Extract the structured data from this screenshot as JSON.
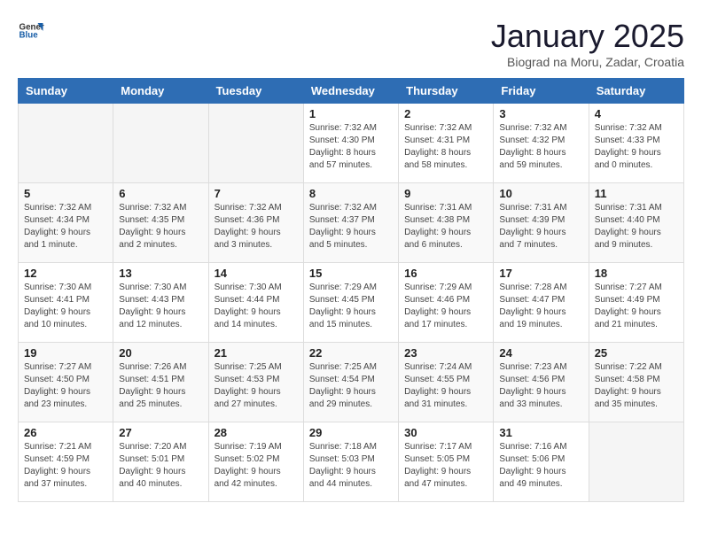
{
  "logo": {
    "text_general": "General",
    "text_blue": "Blue"
  },
  "title": "January 2025",
  "subtitle": "Biograd na Moru, Zadar, Croatia",
  "weekdays": [
    "Sunday",
    "Monday",
    "Tuesday",
    "Wednesday",
    "Thursday",
    "Friday",
    "Saturday"
  ],
  "weeks": [
    [
      {
        "day": "",
        "info": ""
      },
      {
        "day": "",
        "info": ""
      },
      {
        "day": "",
        "info": ""
      },
      {
        "day": "1",
        "info": "Sunrise: 7:32 AM\nSunset: 4:30 PM\nDaylight: 8 hours and 57 minutes."
      },
      {
        "day": "2",
        "info": "Sunrise: 7:32 AM\nSunset: 4:31 PM\nDaylight: 8 hours and 58 minutes."
      },
      {
        "day": "3",
        "info": "Sunrise: 7:32 AM\nSunset: 4:32 PM\nDaylight: 8 hours and 59 minutes."
      },
      {
        "day": "4",
        "info": "Sunrise: 7:32 AM\nSunset: 4:33 PM\nDaylight: 9 hours and 0 minutes."
      }
    ],
    [
      {
        "day": "5",
        "info": "Sunrise: 7:32 AM\nSunset: 4:34 PM\nDaylight: 9 hours and 1 minute."
      },
      {
        "day": "6",
        "info": "Sunrise: 7:32 AM\nSunset: 4:35 PM\nDaylight: 9 hours and 2 minutes."
      },
      {
        "day": "7",
        "info": "Sunrise: 7:32 AM\nSunset: 4:36 PM\nDaylight: 9 hours and 3 minutes."
      },
      {
        "day": "8",
        "info": "Sunrise: 7:32 AM\nSunset: 4:37 PM\nDaylight: 9 hours and 5 minutes."
      },
      {
        "day": "9",
        "info": "Sunrise: 7:31 AM\nSunset: 4:38 PM\nDaylight: 9 hours and 6 minutes."
      },
      {
        "day": "10",
        "info": "Sunrise: 7:31 AM\nSunset: 4:39 PM\nDaylight: 9 hours and 7 minutes."
      },
      {
        "day": "11",
        "info": "Sunrise: 7:31 AM\nSunset: 4:40 PM\nDaylight: 9 hours and 9 minutes."
      }
    ],
    [
      {
        "day": "12",
        "info": "Sunrise: 7:30 AM\nSunset: 4:41 PM\nDaylight: 9 hours and 10 minutes."
      },
      {
        "day": "13",
        "info": "Sunrise: 7:30 AM\nSunset: 4:43 PM\nDaylight: 9 hours and 12 minutes."
      },
      {
        "day": "14",
        "info": "Sunrise: 7:30 AM\nSunset: 4:44 PM\nDaylight: 9 hours and 14 minutes."
      },
      {
        "day": "15",
        "info": "Sunrise: 7:29 AM\nSunset: 4:45 PM\nDaylight: 9 hours and 15 minutes."
      },
      {
        "day": "16",
        "info": "Sunrise: 7:29 AM\nSunset: 4:46 PM\nDaylight: 9 hours and 17 minutes."
      },
      {
        "day": "17",
        "info": "Sunrise: 7:28 AM\nSunset: 4:47 PM\nDaylight: 9 hours and 19 minutes."
      },
      {
        "day": "18",
        "info": "Sunrise: 7:27 AM\nSunset: 4:49 PM\nDaylight: 9 hours and 21 minutes."
      }
    ],
    [
      {
        "day": "19",
        "info": "Sunrise: 7:27 AM\nSunset: 4:50 PM\nDaylight: 9 hours and 23 minutes."
      },
      {
        "day": "20",
        "info": "Sunrise: 7:26 AM\nSunset: 4:51 PM\nDaylight: 9 hours and 25 minutes."
      },
      {
        "day": "21",
        "info": "Sunrise: 7:25 AM\nSunset: 4:53 PM\nDaylight: 9 hours and 27 minutes."
      },
      {
        "day": "22",
        "info": "Sunrise: 7:25 AM\nSunset: 4:54 PM\nDaylight: 9 hours and 29 minutes."
      },
      {
        "day": "23",
        "info": "Sunrise: 7:24 AM\nSunset: 4:55 PM\nDaylight: 9 hours and 31 minutes."
      },
      {
        "day": "24",
        "info": "Sunrise: 7:23 AM\nSunset: 4:56 PM\nDaylight: 9 hours and 33 minutes."
      },
      {
        "day": "25",
        "info": "Sunrise: 7:22 AM\nSunset: 4:58 PM\nDaylight: 9 hours and 35 minutes."
      }
    ],
    [
      {
        "day": "26",
        "info": "Sunrise: 7:21 AM\nSunset: 4:59 PM\nDaylight: 9 hours and 37 minutes."
      },
      {
        "day": "27",
        "info": "Sunrise: 7:20 AM\nSunset: 5:01 PM\nDaylight: 9 hours and 40 minutes."
      },
      {
        "day": "28",
        "info": "Sunrise: 7:19 AM\nSunset: 5:02 PM\nDaylight: 9 hours and 42 minutes."
      },
      {
        "day": "29",
        "info": "Sunrise: 7:18 AM\nSunset: 5:03 PM\nDaylight: 9 hours and 44 minutes."
      },
      {
        "day": "30",
        "info": "Sunrise: 7:17 AM\nSunset: 5:05 PM\nDaylight: 9 hours and 47 minutes."
      },
      {
        "day": "31",
        "info": "Sunrise: 7:16 AM\nSunset: 5:06 PM\nDaylight: 9 hours and 49 minutes."
      },
      {
        "day": "",
        "info": ""
      }
    ]
  ]
}
